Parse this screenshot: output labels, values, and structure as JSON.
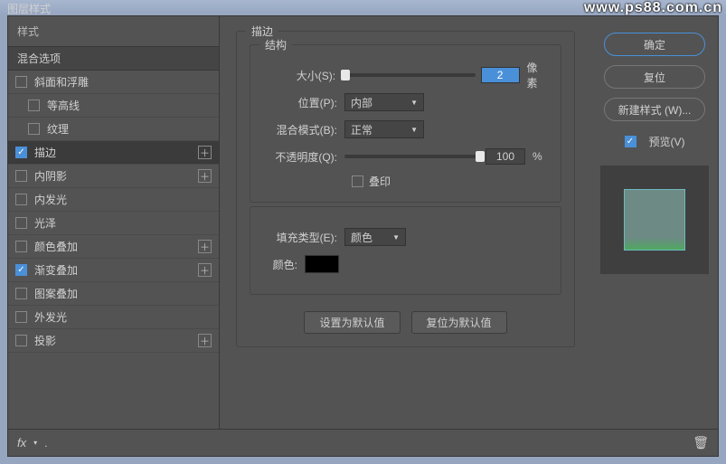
{
  "window": {
    "title": "图层样式",
    "watermark": "www.ps88.com.cn"
  },
  "left": {
    "styles_header": "样式",
    "blend_options": "混合选项",
    "items": [
      {
        "label": "斜面和浮雕",
        "checked": false,
        "indent": false,
        "plus": false
      },
      {
        "label": "等高线",
        "checked": false,
        "indent": true,
        "plus": false
      },
      {
        "label": "纹理",
        "checked": false,
        "indent": true,
        "plus": false
      },
      {
        "label": "描边",
        "checked": true,
        "indent": false,
        "plus": true,
        "selected": true
      },
      {
        "label": "内阴影",
        "checked": false,
        "indent": false,
        "plus": true
      },
      {
        "label": "内发光",
        "checked": false,
        "indent": false,
        "plus": false
      },
      {
        "label": "光泽",
        "checked": false,
        "indent": false,
        "plus": false
      },
      {
        "label": "颜色叠加",
        "checked": false,
        "indent": false,
        "plus": true
      },
      {
        "label": "渐变叠加",
        "checked": true,
        "indent": false,
        "plus": true
      },
      {
        "label": "图案叠加",
        "checked": false,
        "indent": false,
        "plus": false
      },
      {
        "label": "外发光",
        "checked": false,
        "indent": false,
        "plus": false
      },
      {
        "label": "投影",
        "checked": false,
        "indent": false,
        "plus": true
      }
    ],
    "fx": "fx",
    "trash": "🗑"
  },
  "center": {
    "group_title": "描边",
    "structure_title": "结构",
    "size_label": "大小(S):",
    "size_value": "2",
    "size_unit": "像素",
    "position_label": "位置(P):",
    "position_value": "内部",
    "blendmode_label": "混合模式(B):",
    "blendmode_value": "正常",
    "opacity_label": "不透明度(Q):",
    "opacity_value": "100",
    "opacity_unit": "%",
    "overprint_label": "叠印",
    "filltype_label": "填充类型(E):",
    "filltype_value": "颜色",
    "color_label": "颜色:",
    "btn_default": "设置为默认值",
    "btn_reset": "复位为默认值"
  },
  "right": {
    "ok": "确定",
    "reset": "复位",
    "newstyle": "新建样式 (W)...",
    "preview": "预览(V)"
  }
}
